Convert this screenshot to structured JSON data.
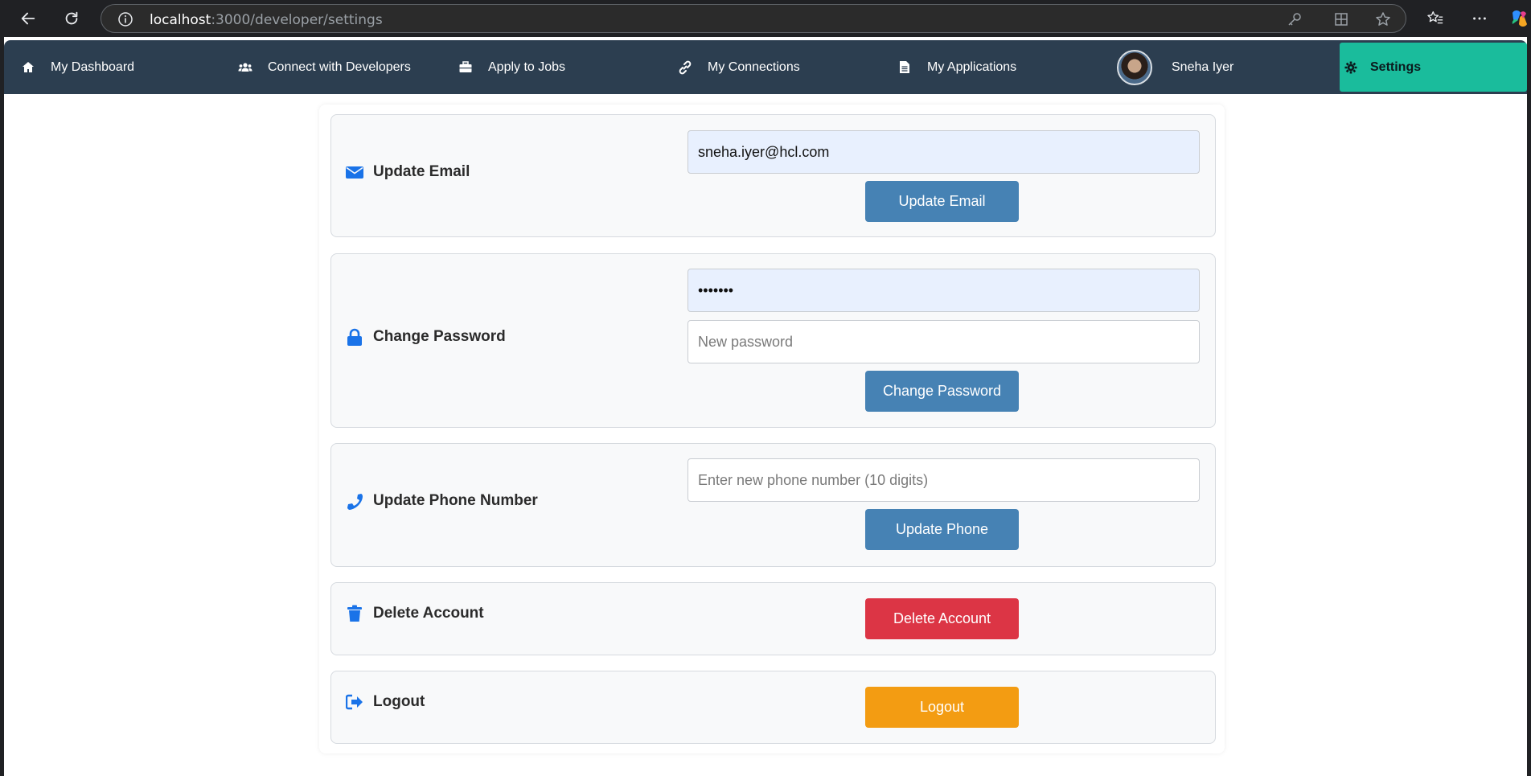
{
  "browser": {
    "url_host": "localhost",
    "url_path": ":3000/developer/settings"
  },
  "nav": {
    "dashboard": "My Dashboard",
    "connect": "Connect with Developers",
    "jobs": "Apply to Jobs",
    "connections": "My Connections",
    "applications": "My Applications",
    "user_name": "Sneha Iyer",
    "settings": "Settings"
  },
  "email_section": {
    "label": "Update Email",
    "email_value": "sneha.iyer@hcl.com",
    "button": "Update Email"
  },
  "password_section": {
    "label": "Change Password",
    "current_value": "•••••••",
    "new_placeholder": "New password",
    "button": "Change Password"
  },
  "phone_section": {
    "label": "Update Phone Number",
    "placeholder": "Enter new phone number (10 digits)",
    "button": "Update Phone"
  },
  "delete_section": {
    "label": "Delete Account",
    "button": "Delete Account"
  },
  "logout_section": {
    "label": "Logout",
    "button": "Logout"
  },
  "colors": {
    "nav_bg": "#2c3e50",
    "settings_active": "#1abc9c",
    "primary_button": "#4682b4",
    "danger_button": "#dc3545",
    "warning_button": "#f39c12",
    "icon_blue": "#1a73e8"
  }
}
